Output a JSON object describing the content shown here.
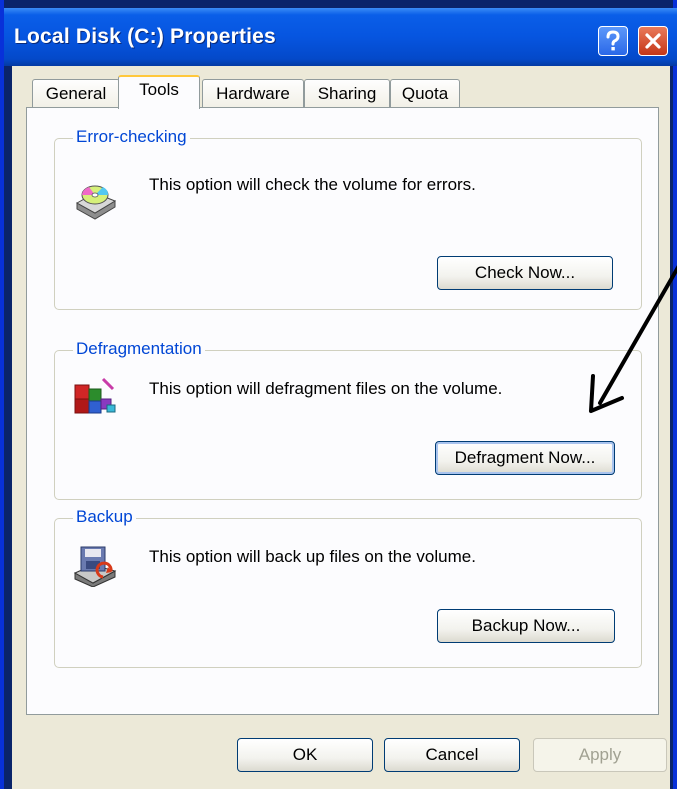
{
  "window": {
    "title": "Local Disk (C:) Properties"
  },
  "titlebar_buttons": {
    "help": "?",
    "close": "✕"
  },
  "tabs": [
    {
      "label": "General"
    },
    {
      "label": "Tools"
    },
    {
      "label": "Hardware"
    },
    {
      "label": "Sharing"
    },
    {
      "label": "Quota"
    }
  ],
  "active_tab": "Tools",
  "groups": {
    "error_checking": {
      "label": "Error-checking",
      "description": "This option will check the volume for errors.",
      "button": "Check Now..."
    },
    "defragmentation": {
      "label": "Defragmentation",
      "description": "This option will defragment files on the volume.",
      "button": "Defragment Now..."
    },
    "backup": {
      "label": "Backup",
      "description": "This option will back up files on the volume.",
      "button": "Backup Now..."
    }
  },
  "footer": {
    "ok": "OK",
    "cancel": "Cancel",
    "apply": "Apply"
  },
  "colors": {
    "title_bar": "#0655e0",
    "group_label": "#0046d5",
    "dialog_face": "#ece9d8"
  }
}
